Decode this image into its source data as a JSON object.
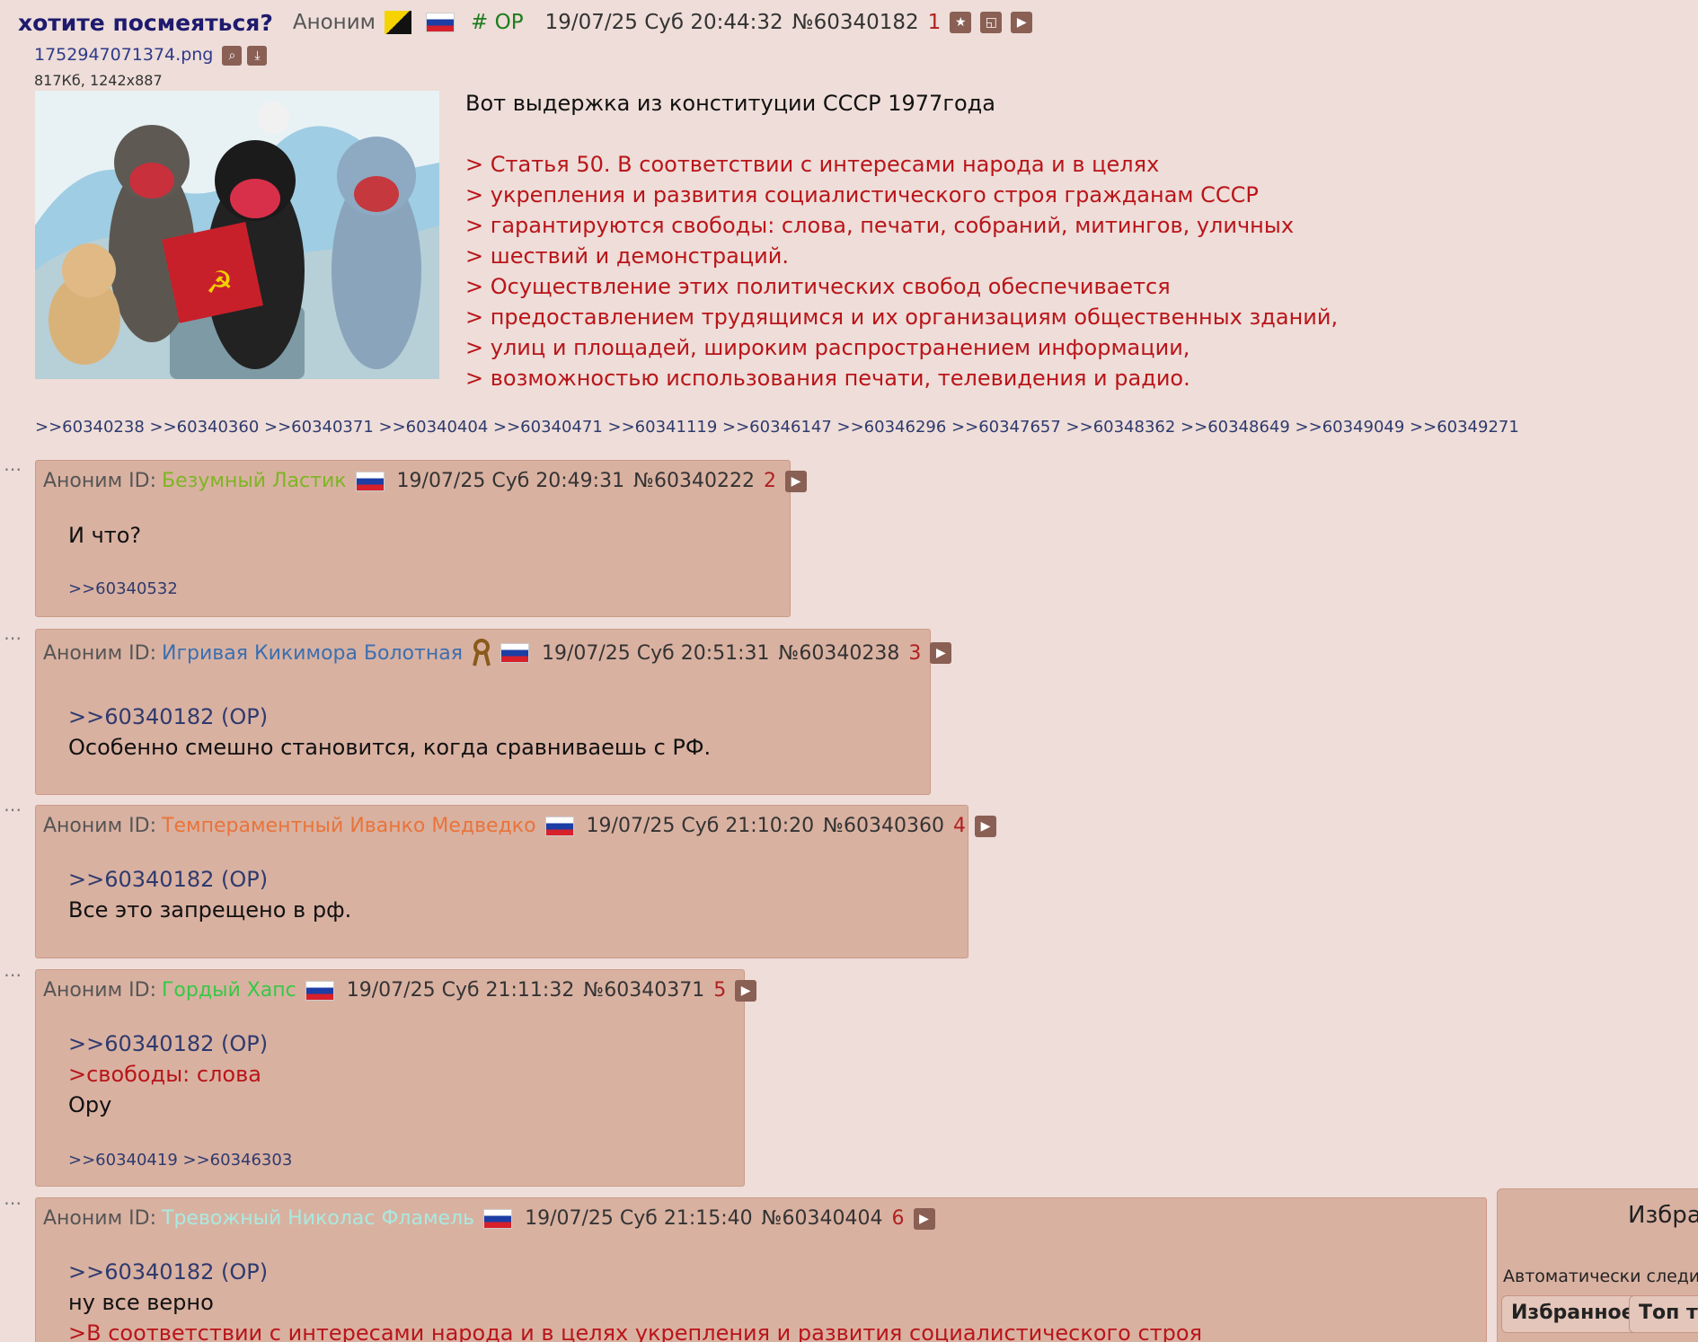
{
  "op": {
    "title": "хотите посмеяться?",
    "name": "Аноним",
    "op_mark": "# OP",
    "date": "19/07/25 Суб 20:44:32",
    "num": "№60340182",
    "ord": "1",
    "file_name": "1752947071374.png",
    "file_meta": "817Кб, 1242x887",
    "text_intro": "Вот выдержка из конституции СССР 1977года",
    "quotes": [
      "> Статья 50. В соответствии с интересами народа и в целях",
      "> укрепления и развития социалистического строя гражданам СССР",
      "> гарантируются свободы: слова, печати, собраний, митингов, уличных",
      "> шествий и демонстраций.",
      "> Осуществление этих политических свобод обеспечивается",
      "> предоставлением трудящимся и их организациям общественных зданий,",
      "> улиц и площадей, широким распространением информации,",
      "> возможностью использования печати, телевидения и радио."
    ],
    "replies": ">>60340238 >>60340360 >>60340371 >>60340404 >>60340471 >>60341119 >>60346147 >>60346296 >>60347657 >>60348362 >>60348649 >>60349049 >>60349271"
  },
  "posts": [
    {
      "anon": "Аноним ID:",
      "id_name": "Безумный Ластик",
      "id_color": "#7db523",
      "date": "19/07/25 Суб 20:49:31",
      "num": "№60340222",
      "ord": "2",
      "body": "И что?",
      "replies": ">>60340532"
    },
    {
      "anon": "Аноним ID:",
      "id_name": "Игривая Кикимора Болотная",
      "id_color": "#3a6fb0",
      "date": "19/07/25 Суб 20:51:31",
      "num": "№60340238",
      "ord": "3",
      "reply_to": ">>60340182 (OP)",
      "body": "Особенно смешно становится, когда сравниваешь с РФ."
    },
    {
      "anon": "Аноним ID:",
      "id_name": "Темпераментный Иванко Медведко",
      "id_color": "#e8743a",
      "date": "19/07/25 Суб 21:10:20",
      "num": "№60340360",
      "ord": "4",
      "reply_to": ">>60340182 (OP)",
      "body": "Все это запрещено в рф."
    },
    {
      "anon": "Аноним ID:",
      "id_name": "Гордый Хапс",
      "id_color": "#36c846",
      "date": "19/07/25 Суб 21:11:32",
      "num": "№60340371",
      "ord": "5",
      "reply_to": ">>60340182 (OP)",
      "quote": ">свободы: слова",
      "body": "Ору",
      "replies": ">>60340419 >>60346303"
    },
    {
      "anon": "Аноним ID:",
      "id_name": "Тревожный Николас Фламель",
      "id_color": "#a9eae0",
      "date": "19/07/25 Суб 21:15:40",
      "num": "№60340404",
      "ord": "6",
      "reply_to": ">>60340182 (OP)",
      "body": "ну все верно",
      "quote": ">В соответствии с интересами народа и в целях укрепления и развития социалистического строя"
    }
  ],
  "panel": {
    "title": "Избран",
    "auto_follow": "Автоматически следить",
    "tab_favorites": "Избранное",
    "tab_top": "Топ тр"
  }
}
